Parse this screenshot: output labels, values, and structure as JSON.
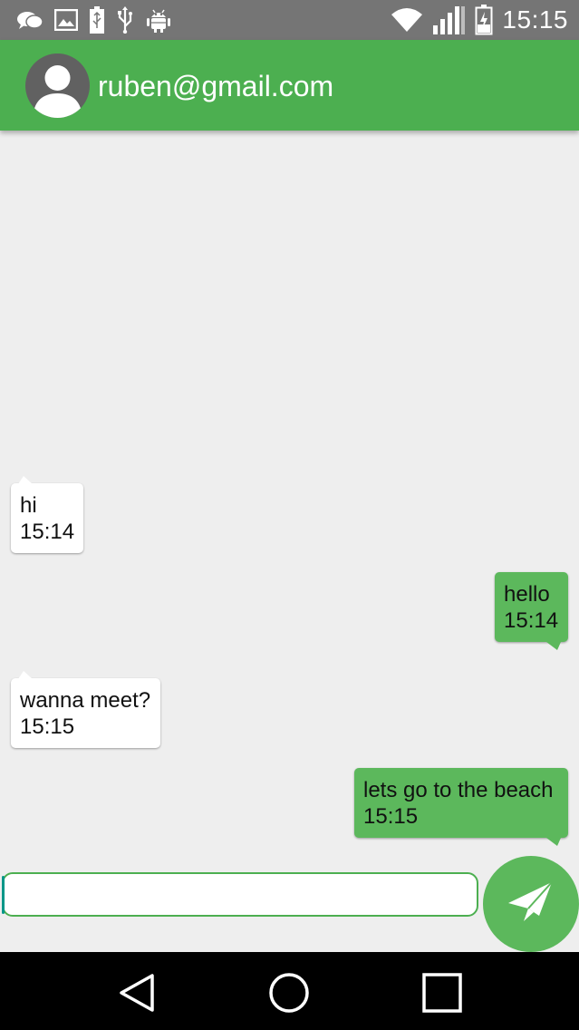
{
  "status_bar": {
    "time": "15:15",
    "left_icons": [
      "chat-notification-icon",
      "gallery-notification-icon",
      "battery-status-icon",
      "usb-icon",
      "android-debug-icon"
    ],
    "right_icons": [
      "wifi-icon",
      "cell-signal-icon",
      "battery-charging-icon"
    ]
  },
  "header": {
    "contact_email": "ruben@gmail.com",
    "avatar_icon": "default-avatar-icon"
  },
  "messages": [
    {
      "direction": "incoming",
      "text": "hi",
      "time": "15:14"
    },
    {
      "direction": "outgoing",
      "text": "hello",
      "time": "15:14"
    },
    {
      "direction": "incoming",
      "text": "wanna meet?",
      "time": "15:15"
    },
    {
      "direction": "outgoing",
      "text": "lets go to the beach",
      "time": "15:15"
    }
  ],
  "composer": {
    "input_value": "",
    "send_icon": "paper-plane-icon"
  },
  "nav_bar": {
    "icons": [
      "back-icon",
      "home-icon",
      "recents-icon"
    ]
  },
  "colors": {
    "app_bar": "#4caf50",
    "outgoing_bubble": "#5cb85c",
    "incoming_bubble": "#ffffff",
    "background": "#eeeeee",
    "status_bar": "#757575"
  }
}
